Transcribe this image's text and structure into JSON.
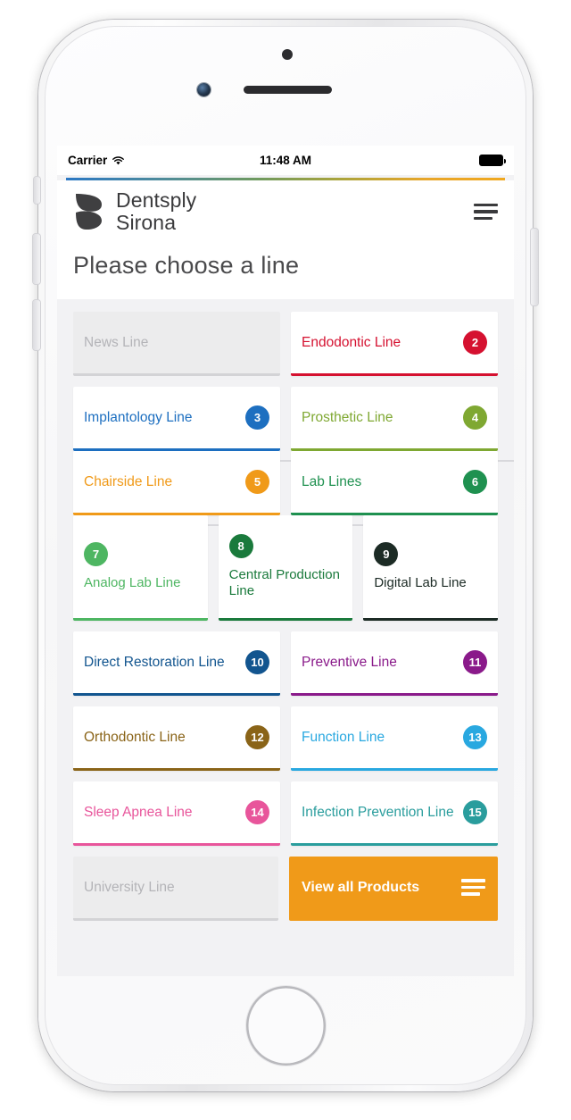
{
  "status_bar": {
    "carrier": "Carrier",
    "time": "11:48 AM",
    "wifi_icon": "wifi-icon",
    "battery_icon": "battery-full-icon"
  },
  "header": {
    "brand_line1": "Dentsply",
    "brand_line2": "Sirona",
    "logo_icon": "dentsply-sirona-logo",
    "menu_icon": "hamburger-menu-icon",
    "page_title": "Please choose a line",
    "gradient": [
      "#2b78c4",
      "#6f9a5e",
      "#f0a81f"
    ]
  },
  "cards": [
    {
      "label": "News Line",
      "badge": "",
      "color": "#b4b4b8",
      "disabled": true,
      "stacked": false
    },
    {
      "label": "Endodontic Line",
      "badge": "2",
      "color": "#d51130",
      "disabled": false,
      "stacked": false
    },
    {
      "label": "Implantology Line",
      "badge": "3",
      "color": "#1d6fc0",
      "disabled": false,
      "stacked": false
    },
    {
      "label": "Prosthetic Line",
      "badge": "4",
      "color": "#7fa832",
      "disabled": false,
      "stacked": false
    },
    {
      "label": "Chairside Line",
      "badge": "5",
      "color": "#f09a19",
      "disabled": false,
      "stacked": false
    },
    {
      "label": "Lab Lines",
      "badge": "6",
      "color": "#1f9150",
      "disabled": false,
      "stacked": false
    },
    {
      "label": "Analog Lab Line",
      "badge": "7",
      "color": "#4eb662",
      "disabled": false,
      "stacked": true
    },
    {
      "label": "Central Production Line",
      "badge": "8",
      "color": "#1a7a3c",
      "disabled": false,
      "stacked": true
    },
    {
      "label": "Digital Lab Line",
      "badge": "9",
      "color": "#1c2b25",
      "disabled": false,
      "stacked": true
    },
    {
      "label": "Direct Restoration Line",
      "badge": "10",
      "color": "#12558f",
      "disabled": false,
      "stacked": false
    },
    {
      "label": "Preventive Line",
      "badge": "11",
      "color": "#8a1a8a",
      "disabled": false,
      "stacked": false
    },
    {
      "label": "Orthodontic Line",
      "badge": "12",
      "color": "#8a6418",
      "disabled": false,
      "stacked": false
    },
    {
      "label": "Function Line",
      "badge": "13",
      "color": "#29a8e0",
      "disabled": false,
      "stacked": false
    },
    {
      "label": "Sleep Apnea Line",
      "badge": "14",
      "color": "#e8559b",
      "disabled": false,
      "stacked": false
    },
    {
      "label": "Infection Prevention Line",
      "badge": "15",
      "color": "#2a9d9d",
      "disabled": false,
      "stacked": false
    },
    {
      "label": "University Line",
      "badge": "",
      "color": "#b4b4b8",
      "disabled": true,
      "stacked": false
    }
  ],
  "cta": {
    "label": "View all Products",
    "icon": "hamburger-menu-icon",
    "background": "#f09a19"
  }
}
